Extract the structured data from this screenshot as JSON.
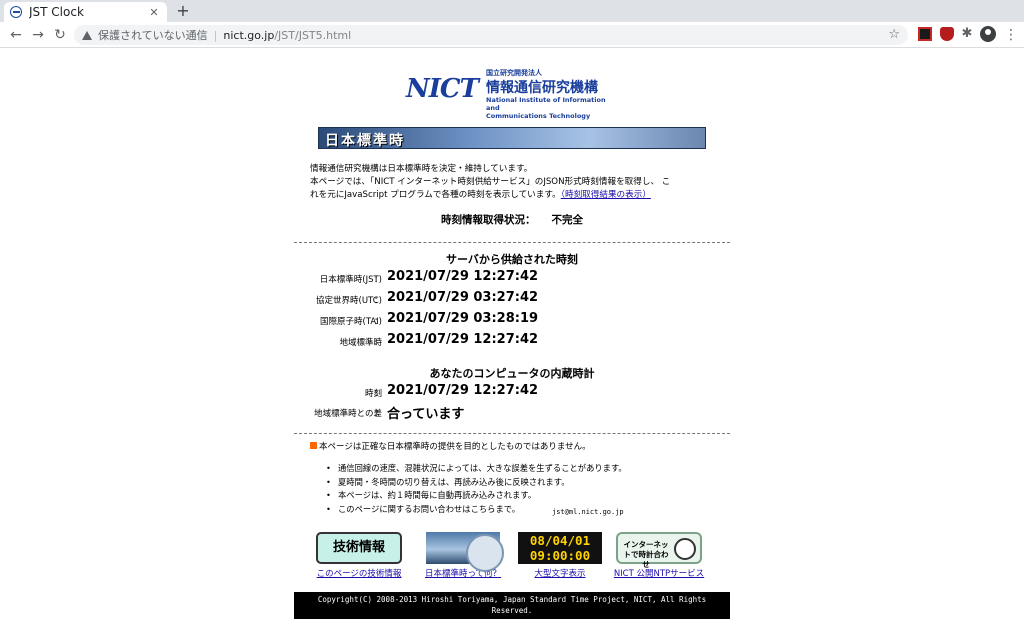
{
  "browser": {
    "tab_title": "JST Clock",
    "tab_close": "✕",
    "new_tab": "+",
    "back": "←",
    "forward": "→",
    "reload": "↻",
    "security_label": "保護されていない通信",
    "separator": "|",
    "url_host": "nict.go.jp",
    "url_path": "/JST/JST5.html",
    "star": "☆",
    "extensions_icon": "✱",
    "menu": "⋮"
  },
  "logo": {
    "mark": "NICT",
    "org_small": "国立研究開発法人",
    "org_name": "情報通信研究機構",
    "org_en_1": "National Institute of Information and",
    "org_en_2": "Communications Technology"
  },
  "banner": {
    "title": "日本標準時"
  },
  "intro": {
    "line1": "情報通信研究機構は日本標準時を決定・維持しています。",
    "line2": "本ページでは、「NICT インターネット時刻供給サービス」のJSON形式時刻情報を取得し、 こ",
    "line3": "れを元にJavaScript プログラムで各種の時刻を表示しています。",
    "link": "（時刻取得結果の表示）"
  },
  "status": {
    "label": "時刻情報取得状況：",
    "value": "不完全"
  },
  "server": {
    "title": "サーバから供給された時刻",
    "rows": [
      {
        "label": "日本標準時(JST)",
        "colon": "：",
        "value": "2021/07/29 12:27:42"
      },
      {
        "label": "協定世界時(UTC)",
        "colon": "：",
        "value": "2021/07/29 03:27:42"
      },
      {
        "label": "国際原子時(TAI)",
        "colon": "：",
        "value": "2021/07/29 03:28:19"
      },
      {
        "label": "地域標準時",
        "colon": "：",
        "value": "2021/07/29 12:27:42"
      }
    ]
  },
  "local": {
    "title": "あなたのコンピュータの内蔵時計",
    "rows": [
      {
        "label": "時刻",
        "colon": "：",
        "value": "2021/07/29 12:27:42"
      },
      {
        "label": "地域標準時との差",
        "colon": "：",
        "value": "合っています"
      }
    ]
  },
  "notice": "本ページは正確な日本標準時の提供を目的としたものではありません。",
  "bullets": [
    "通信回線の速度、混雑状況によっては、大きな誤差を生ずることがあります。",
    "夏時間・冬時間の切り替えは、再読み込み後に反映されます。",
    "本ページは、約１時間毎に自動再読み込みされます。",
    "このページに関するお問い合わせはこちらまで。"
  ],
  "contact_email": "jst@ml.nict.go.jp",
  "links": [
    {
      "image_text": "技術情報",
      "caption": "このページの技術情報"
    },
    {
      "image_text": "",
      "caption": "日本標準時って何？"
    },
    {
      "image_text_1": "08/04/01",
      "image_text_2": "09:00:00",
      "caption": "大型文字表示"
    },
    {
      "image_text": "インターネットで時計合わせ",
      "caption": "NICT 公開NTPサービス"
    }
  ],
  "footer": {
    "line1": "Copyright(C) 2008-2013 Hiroshi Toriyama, Japan Standard Time Project, NICT, All Rights",
    "line2": "Reserved."
  },
  "colors": {
    "nict_blue": "#1a3e9b",
    "link": "#1a0dab",
    "notice_mark": "#ff6600"
  }
}
